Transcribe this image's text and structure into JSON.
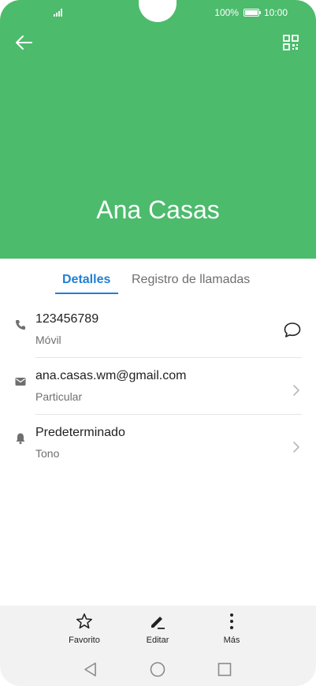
{
  "status": {
    "battery_percent": "100%",
    "time": "10:00",
    "battery_level": 1.0
  },
  "header": {
    "contact_name": "Ana Casas"
  },
  "tabs": [
    {
      "label": "Detalles",
      "active": true
    },
    {
      "label": "Registro de llamadas",
      "active": false
    }
  ],
  "details": {
    "phone": {
      "value": "123456789",
      "type": "Móvil"
    },
    "email": {
      "value": "ana.casas.wm@gmail.com",
      "type": "Particular"
    },
    "ringtone": {
      "value": "Predeterminado",
      "type": "Tono"
    }
  },
  "actions": [
    {
      "label": "Favorito",
      "icon": "star-icon"
    },
    {
      "label": "Editar",
      "icon": "edit-icon"
    },
    {
      "label": "Más",
      "icon": "more-vertical-icon"
    }
  ],
  "colors": {
    "accent": "#1f7fd6",
    "header": "#4cbb6c"
  }
}
